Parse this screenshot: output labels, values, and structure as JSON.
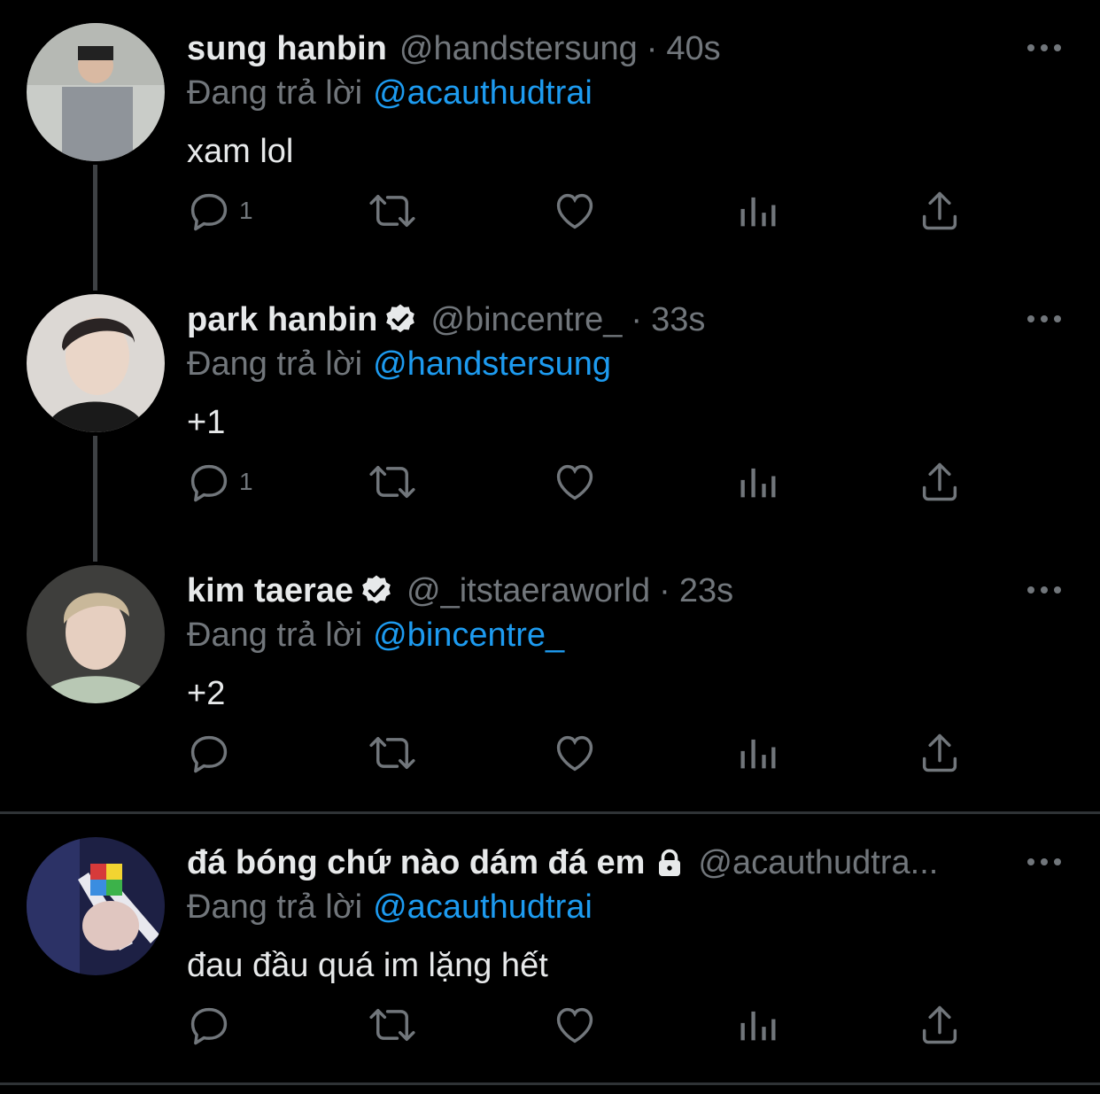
{
  "tweets": [
    {
      "name": "sung hanbin",
      "verified": false,
      "locked": false,
      "handle": "@handstersung",
      "dot": "·",
      "time": "40s",
      "replying_label": "Đang trả lời",
      "replying_to": "@acauthudtrai",
      "text": "xam lol",
      "reply_count": "1",
      "avatar_color": "#c9ccc8"
    },
    {
      "name": "park hanbin",
      "verified": true,
      "locked": false,
      "handle": "@bincentre_",
      "dot": "·",
      "time": "33s",
      "replying_label": "Đang trả lời",
      "replying_to": "@handstersung",
      "text": "+1",
      "reply_count": "1",
      "avatar_color": "#d8d4d0"
    },
    {
      "name": "kim taerae",
      "verified": true,
      "locked": false,
      "handle": "@_itstaeraworld",
      "dot": "·",
      "time": "23s",
      "replying_label": "Đang trả lời",
      "replying_to": "@bincentre_",
      "text": "+2",
      "reply_count": "",
      "avatar_color": "#5a5a58"
    },
    {
      "name": "đá bóng chứ nào dám đá em",
      "verified": false,
      "locked": true,
      "handle": "@acauthudtra...",
      "dot": "",
      "time": "",
      "replying_label": "Đang trả lời",
      "replying_to": "@acauthudtrai",
      "text": "đau đầu quá im lặng hết",
      "reply_count": "",
      "avatar_color": "#1d2044"
    }
  ],
  "colors": {
    "background": "#000000",
    "text_primary": "#e7e9ea",
    "text_secondary": "#71767b",
    "link": "#1d9bf0",
    "separator": "#2f3336"
  },
  "icons": [
    "more-icon",
    "reply-icon",
    "retweet-icon",
    "like-icon",
    "views-icon",
    "share-icon",
    "verified-badge-icon",
    "lock-icon"
  ]
}
